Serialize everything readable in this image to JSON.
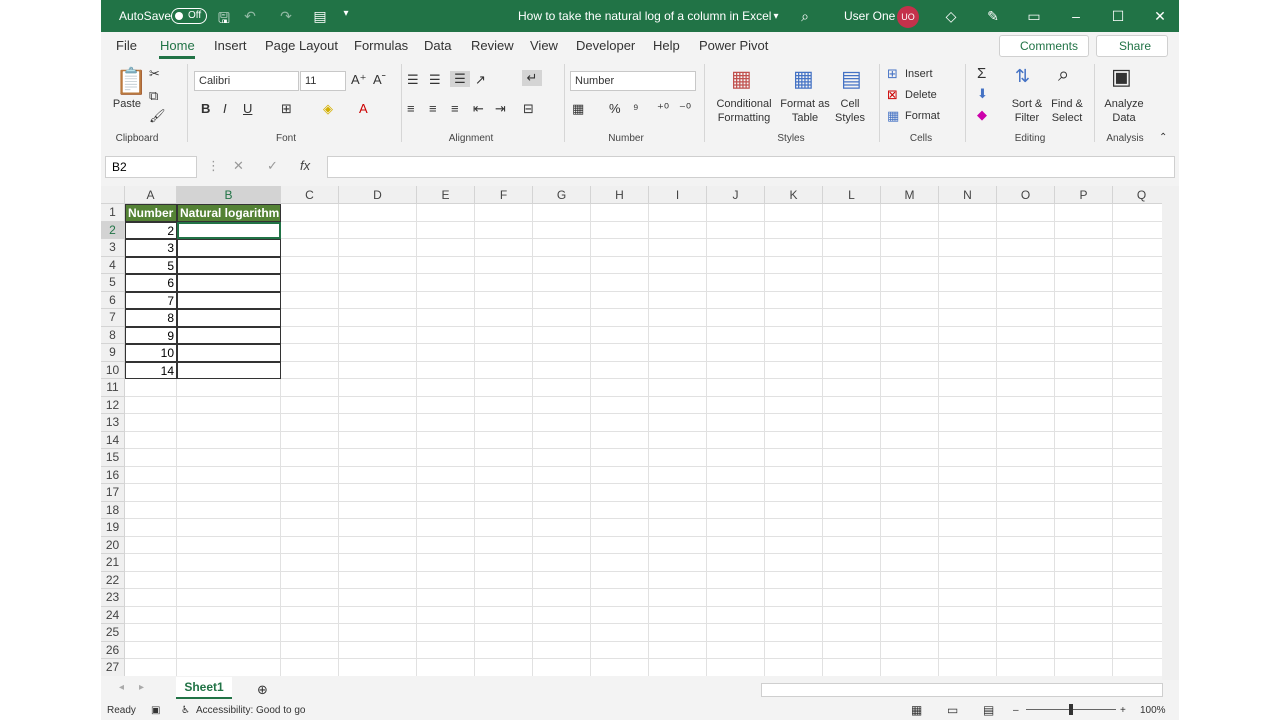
{
  "titlebar": {
    "autosave_label": "AutoSave",
    "autosave_state": "Off",
    "doc_title": "How to take the natural log of a column in Excel",
    "user_name": "User One",
    "user_initials": "UO"
  },
  "menu": [
    "File",
    "Home",
    "Insert",
    "Page Layout",
    "Formulas",
    "Data",
    "Review",
    "View",
    "Developer",
    "Help",
    "Power Pivot"
  ],
  "comments_label": "Comments",
  "share_label": "Share",
  "ribbon": {
    "paste": "Paste",
    "clipboard": "Clipboard",
    "font_name": "Calibri",
    "font_size": "11",
    "font": "Font",
    "alignment": "Alignment",
    "number_format": "Number",
    "number": "Number",
    "cond_fmt_1": "Conditional",
    "cond_fmt_2": "Formatting",
    "fmt_table_1": "Format as",
    "fmt_table_2": "Table",
    "cell_styles_1": "Cell",
    "cell_styles_2": "Styles",
    "styles": "Styles",
    "insert": "Insert",
    "delete": "Delete",
    "format": "Format",
    "cells": "Cells",
    "sort_1": "Sort &",
    "sort_2": "Filter",
    "find_1": "Find &",
    "find_2": "Select",
    "editing": "Editing",
    "analyze_1": "Analyze",
    "analyze_2": "Data",
    "analysis": "Analysis"
  },
  "namebox": "B2",
  "fx_label": "fx",
  "columns": [
    "A",
    "B",
    "C",
    "D",
    "E",
    "F",
    "G",
    "H",
    "I",
    "J",
    "K",
    "L",
    "M",
    "N",
    "O",
    "P",
    "Q"
  ],
  "rows": [
    "1",
    "2",
    "3",
    "4",
    "5",
    "6",
    "7",
    "8",
    "9",
    "10",
    "11",
    "12",
    "13",
    "14",
    "15",
    "16",
    "17",
    "18",
    "19",
    "20",
    "21",
    "22",
    "23",
    "24",
    "25",
    "26",
    "27"
  ],
  "table": {
    "header_a": "Number",
    "header_b": "Natural logarithm",
    "values": [
      "2",
      "3",
      "5",
      "6",
      "7",
      "8",
      "9",
      "10",
      "14"
    ]
  },
  "sheet_tab": "Sheet1",
  "status": {
    "ready": "Ready",
    "accessibility": "Accessibility: Good to go",
    "zoom": "100%"
  }
}
